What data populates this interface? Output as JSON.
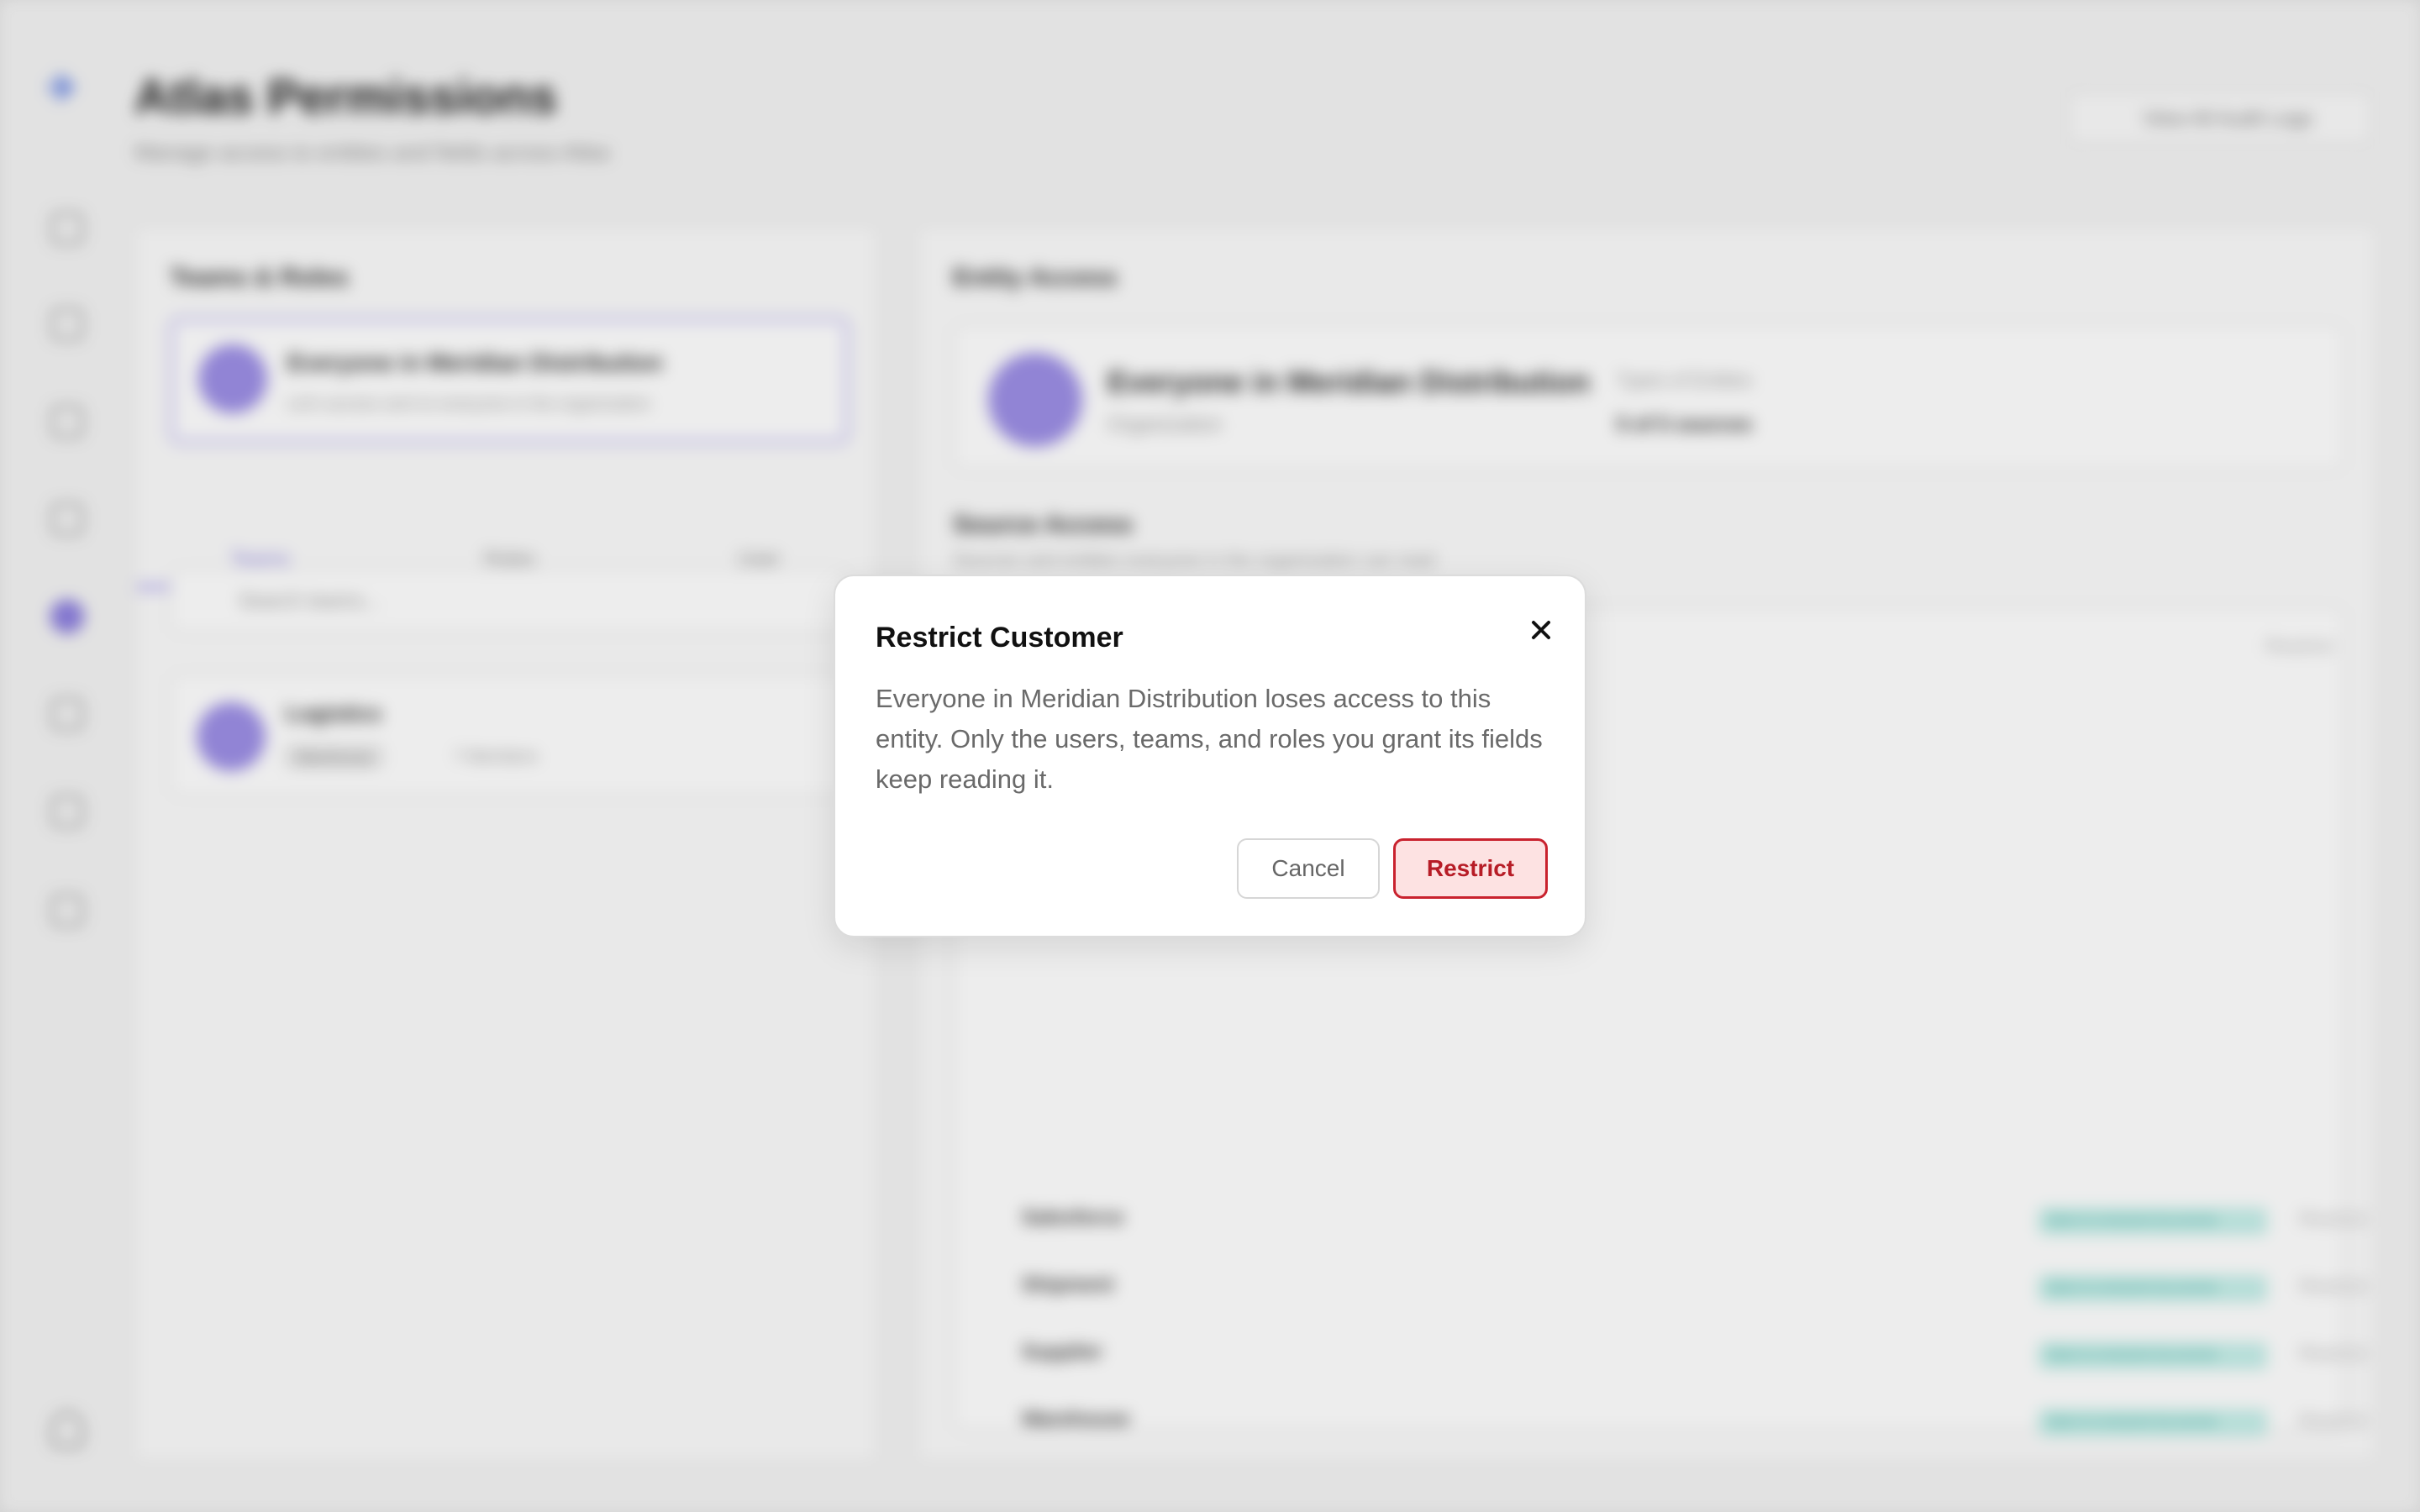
{
  "app": {
    "title": "Atlas Permissions",
    "subtitle": "Manage access to entities and fields across Atlas",
    "audit_button": "View All Audit Logs"
  },
  "sidebar": {
    "logo_icon": "atlas-logo",
    "icons": [
      "home-icon",
      "lightbulb-icon",
      "triangle-icon",
      "grid-icon",
      "permissions-icon",
      "folder-icon",
      "calendar-icon",
      "briefcase-icon"
    ],
    "active": "permissions-icon",
    "user_icon": "user-icon"
  },
  "left_panel": {
    "heading": "Teams & Roles",
    "selected_card": {
      "name": "Everyone in Meridian Distribution",
      "desc": "Let's access sent to everyone in the organization"
    },
    "tabs": [
      "Teams",
      "Roles",
      "User"
    ],
    "search_placeholder": "Search teams...",
    "team_card": {
      "name": "Logistics",
      "badge": "Warehouse",
      "members": "7 Members"
    }
  },
  "right_panel": {
    "heading": "Entity Access",
    "principal": {
      "name": "Everyone in Meridian Distribution",
      "type": "Organization",
      "access_label": "Types of Entities",
      "access_value": "5 of 5 sources"
    },
    "source_heading": "Source Access",
    "source_sub": "Sources and entities everyone in the organization can read",
    "header_action": "Restrict",
    "rows": [
      {
        "name": "Salesforce",
        "tag": "Open to everyone by access",
        "action": "Restrict"
      },
      {
        "name": "Shipment",
        "tag": "Open to everyone by access",
        "action": "Restrict"
      },
      {
        "name": "Supplier",
        "tag": "Open to everyone by access",
        "action": "Restrict"
      },
      {
        "name": "Warehouse",
        "tag": "Open to everyone by access",
        "action": "Restrict"
      }
    ]
  },
  "modal": {
    "title": "Restrict Customer",
    "body": "Everyone in Meridian Distribution loses access to this entity. Only the users, teams, and roles you grant its fields keep reading it.",
    "cancel_label": "Cancel",
    "confirm_label": "Restrict",
    "close_icon": "close-icon",
    "colors": {
      "confirm_bg": "#fde2e2",
      "confirm_border": "#c9222e",
      "confirm_text": "#b71c26"
    }
  }
}
